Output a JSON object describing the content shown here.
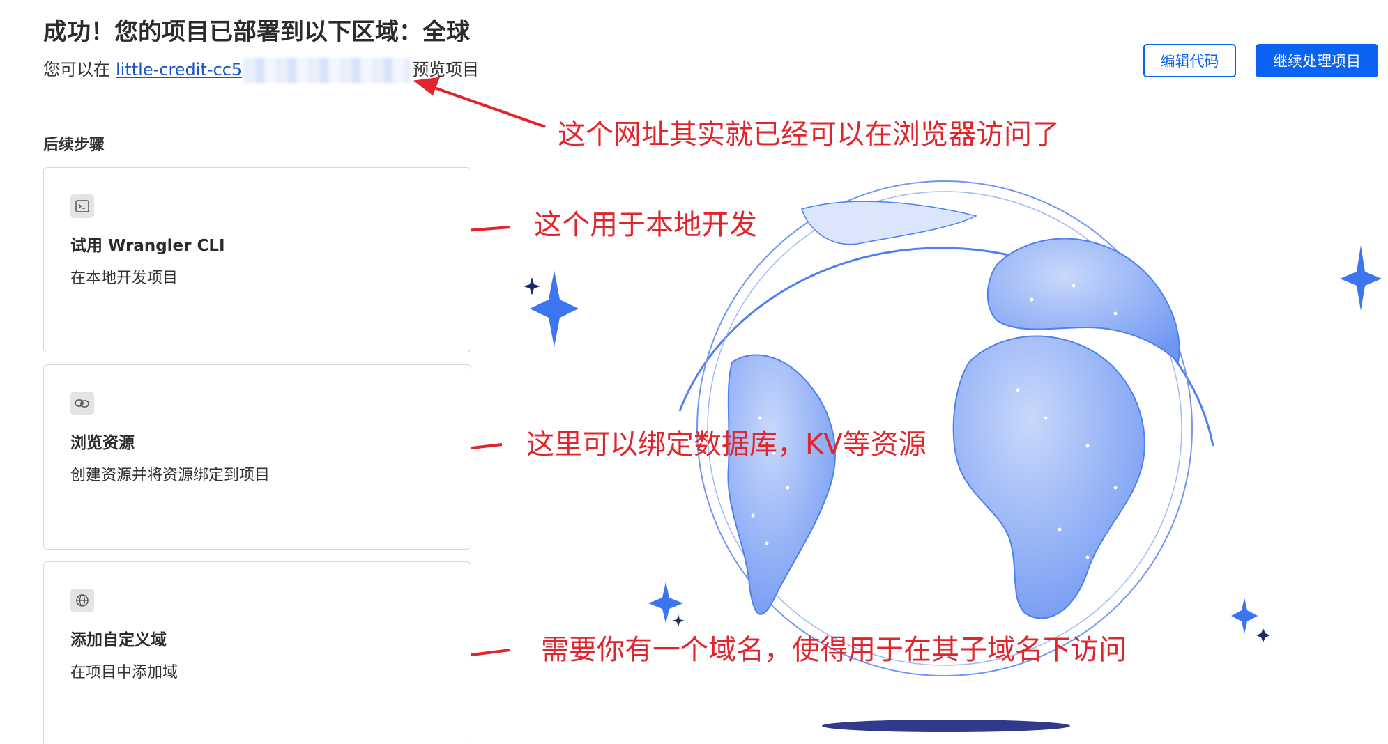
{
  "header": {
    "title": "成功！您的项目已部署到以下区域：全球",
    "subtitle_prefix": "您可以在",
    "preview_link": "little-credit-cc5",
    "subtitle_suffix": "预览项目"
  },
  "actions": {
    "edit_code": "编辑代码",
    "continue": "继续处理项目"
  },
  "next_steps": {
    "label": "后续步骤",
    "cards": [
      {
        "title": "试用 Wrangler CLI",
        "desc": "在本地开发项目",
        "icon": "terminal-icon"
      },
      {
        "title": "浏览资源",
        "desc": "创建资源并将资源绑定到项目",
        "icon": "link-icon"
      },
      {
        "title": "添加自定义域",
        "desc": "在项目中添加域",
        "icon": "globe-icon"
      }
    ]
  },
  "annotations": {
    "url_note": "这个网址其实就已经可以在浏览器访问了",
    "cli_note": "这个用于本地开发",
    "resources_note": "这里可以绑定数据库，KV等资源",
    "domain_note": "需要你有一个域名，使得用于在其子域名下访问"
  },
  "colors": {
    "primary": "#0a63f2",
    "annotation": "#e0262c",
    "globe": "#7fa4f5"
  }
}
